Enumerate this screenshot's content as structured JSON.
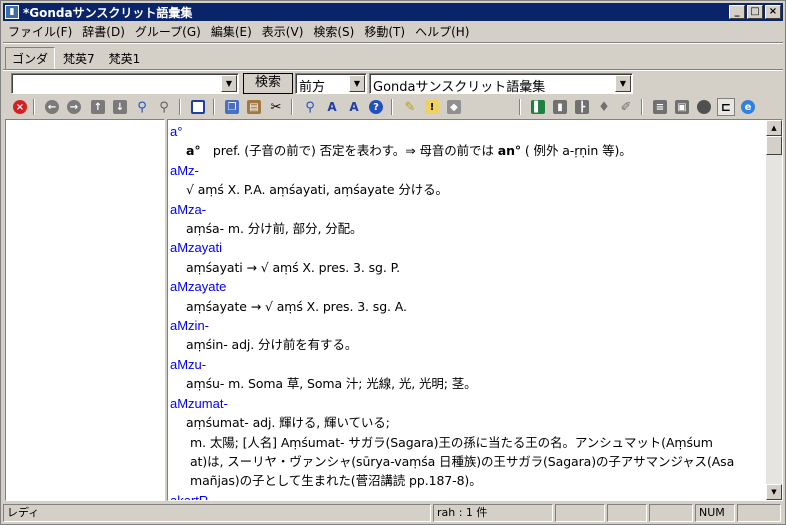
{
  "window": {
    "title": "*Gondaサンスクリット語彙集"
  },
  "menu": [
    "ファイル(F)",
    "辞書(D)",
    "グループ(G)",
    "編集(E)",
    "表示(V)",
    "検索(S)",
    "移動(T)",
    "ヘルプ(H)"
  ],
  "groups": [
    "ゴンダ",
    "梵英7",
    "梵英1"
  ],
  "search": {
    "query": "",
    "button": "検索",
    "mode": "前方",
    "dictionary": "Gondaサンスクリット語彙集"
  },
  "entries": [
    {
      "hw": "a°",
      "lines": [
        "<b>a°</b>　pref. (子音の前で) 否定を表わす。⇒ 母音の前では <b>an°</b> ( 例外 a-ṛṇin 等)。"
      ]
    },
    {
      "hw": "aMz-",
      "lines": [
        "√ aṃś X. P.A. aṃśayati, aṃśayate 分ける。"
      ]
    },
    {
      "hw": "aMza-",
      "lines": [
        "aṃśa- m. 分け前, 部分, 分配。"
      ]
    },
    {
      "hw": "aMzayati",
      "lines": [
        "aṃśayati → √ aṃś X. pres. 3. sg. P."
      ]
    },
    {
      "hw": "aMzayate",
      "lines": [
        "aṃśayate → √ aṃś X. pres. 3. sg. A."
      ]
    },
    {
      "hw": "aMzin-",
      "lines": [
        "aṃśin- adj. 分け前を有する。"
      ]
    },
    {
      "hw": "aMzu-",
      "lines": [
        "aṃśu- m. Soma 草, Soma 汁; 光線, 光, 光明; 茎。"
      ]
    },
    {
      "hw": "aMzumat-",
      "lines": [
        "aṃśumat- adj. 輝ける, 輝いている;",
        " m. 太陽; [人名] Aṃśumat- サガラ(Sagara)王の孫に当たる王の名。アンシュマット(Aṃśum",
        "at)は, スーリヤ・ヴァンシャ(sūrya-vaṃśa 日種族)の王サガラ(Sagara)の子アサマンジャス(Asa",
        "mañjas)の子として生まれた(菅沼講読 pp.187-8)。"
      ]
    },
    {
      "hw": "akartR-",
      "lines": []
    }
  ],
  "status": {
    "ready": "レディ",
    "count": "rah : 1 件",
    "num": "NUM"
  },
  "colors": {
    "titlebar": "#0a246a",
    "headword": "#0000ff",
    "chrome": "#d4d0c8"
  }
}
